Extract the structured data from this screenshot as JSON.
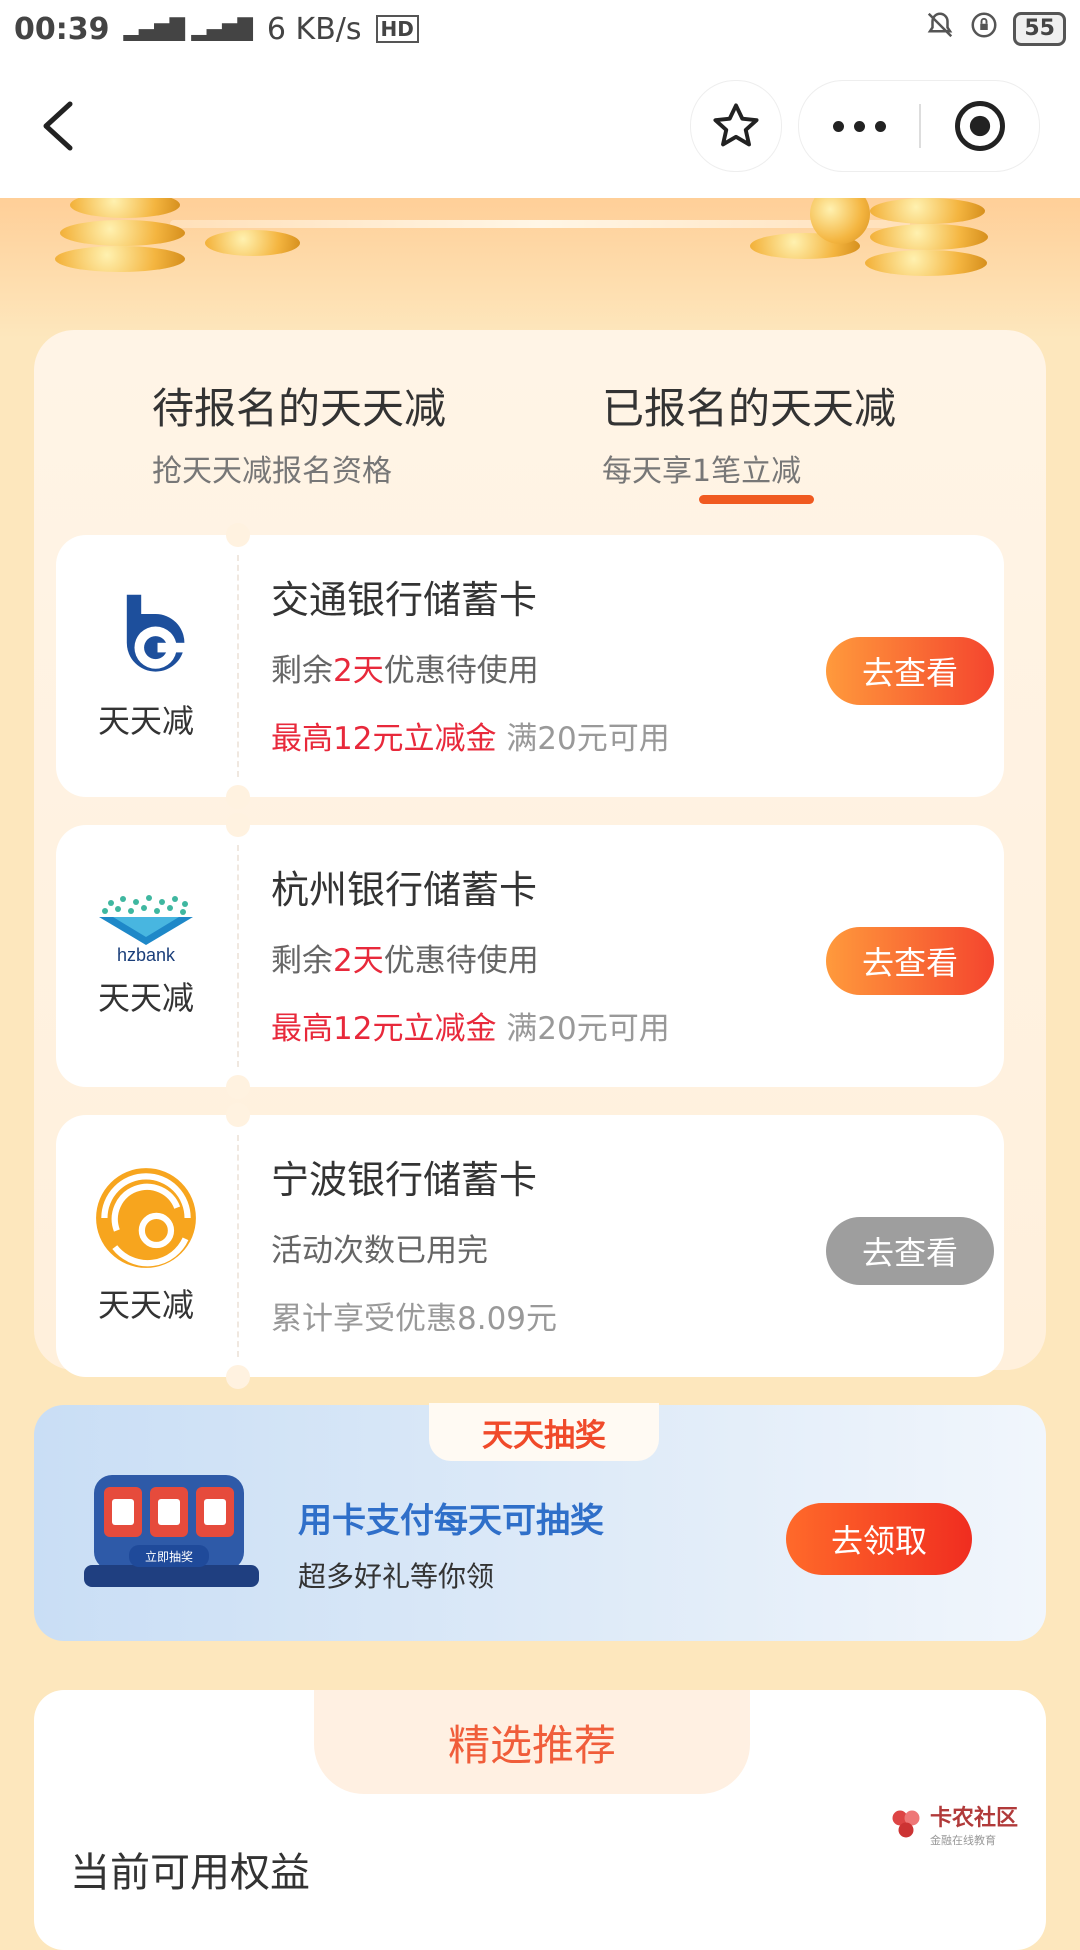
{
  "status_bar": {
    "time": "00:39",
    "speed": "6 KB/s",
    "battery": "55"
  },
  "tabs": [
    {
      "title": "待报名的天天减",
      "subtitle": "抢天天减报名资格"
    },
    {
      "title": "已报名的天天减",
      "subtitle": "每天享1笔立减"
    }
  ],
  "cards": [
    {
      "bank": "交通银行储蓄卡",
      "logo_label": "天天减",
      "line1_pre": "剩余",
      "line1_red": "2天",
      "line1_post": "优惠待使用",
      "line2_red": "最高12元立减金",
      "line2_grey": " 满20元可用",
      "button": "去查看"
    },
    {
      "bank": "杭州银行储蓄卡",
      "logo_label": "天天减",
      "logo_text": "hzbank",
      "line1_pre": "剩余",
      "line1_red": "2天",
      "line1_post": "优惠待使用",
      "line2_red": "最高12元立减金",
      "line2_grey": " 满20元可用",
      "button": "去查看"
    },
    {
      "bank": "宁波银行储蓄卡",
      "logo_label": "天天减",
      "line1": "活动次数已用完",
      "line2": "累计享受优惠8.09元",
      "button": "去查看"
    }
  ],
  "lottery": {
    "tab": "天天抽奖",
    "title": "用卡支付每天可抽奖",
    "subtitle": "超多好礼等你领",
    "button": "去领取",
    "machine_label": "立即抽奖"
  },
  "recommend": {
    "tab": "精选推荐",
    "subtitle": "当前可用权益"
  },
  "watermark": {
    "name": "卡农社区",
    "tagline": "金融在线教育"
  }
}
